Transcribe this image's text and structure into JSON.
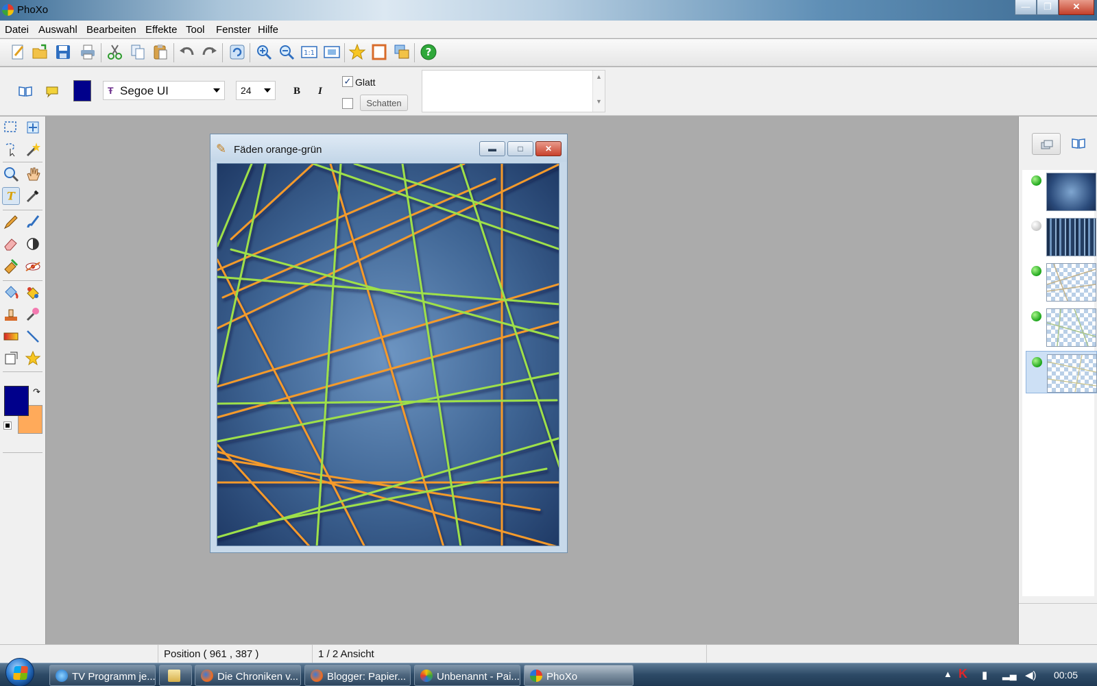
{
  "window": {
    "title": "PhoXo"
  },
  "menu": {
    "items": [
      "Datei",
      "Auswahl",
      "Bearbeiten",
      "Effekte",
      "Tool",
      "Fenster",
      "Hilfe"
    ]
  },
  "toolbar": {
    "buttons": [
      "new-icon",
      "open-icon",
      "save-icon",
      "print-icon",
      "cut-icon",
      "copy-icon",
      "paste-icon",
      "undo-icon",
      "redo-icon",
      "refresh-icon",
      "zoom-in-icon",
      "zoom-out-icon",
      "actual-size-icon",
      "fit-window-icon",
      "favorite-icon",
      "frame-icon",
      "layers-icon",
      "help-icon"
    ]
  },
  "text_options": {
    "color": "#00008b",
    "font": "Segoe UI",
    "size": "24",
    "bold_label": "B",
    "italic_label": "I",
    "smooth_label": "Glatt",
    "smooth_checked": true,
    "shadow_label": "Schatten",
    "shadow_checked": false
  },
  "colors": {
    "foreground": "#00008b",
    "background": "#ffaa5a"
  },
  "document": {
    "title": "Fäden orange-grün",
    "canvas_background": "#3f6594",
    "thread_colors": {
      "orange": "#f59a2a",
      "green": "#9ee04a"
    }
  },
  "layers": [
    {
      "visible": true,
      "kind": "blue-gradient"
    },
    {
      "visible": false,
      "kind": "blue-pattern"
    },
    {
      "visible": true,
      "kind": "threads"
    },
    {
      "visible": true,
      "kind": "threads"
    },
    {
      "visible": true,
      "kind": "threads",
      "selected": true
    }
  ],
  "status": {
    "position": "Position ( 961 , 387 )",
    "view": "1 / 2 Ansicht"
  },
  "taskbar": {
    "tasks": [
      {
        "label": "TV Programm je...",
        "icon": "ie-icon"
      },
      {
        "label": "",
        "icon": "explorer-icon"
      },
      {
        "label": "Die Chroniken v...",
        "icon": "firefox-icon"
      },
      {
        "label": "Blogger: Papier...",
        "icon": "firefox-icon"
      },
      {
        "label": "Unbenannt - Pai...",
        "icon": "paint-icon"
      },
      {
        "label": "PhoXo",
        "icon": "phoxo-icon",
        "active": true
      }
    ],
    "clock": "00:05"
  }
}
